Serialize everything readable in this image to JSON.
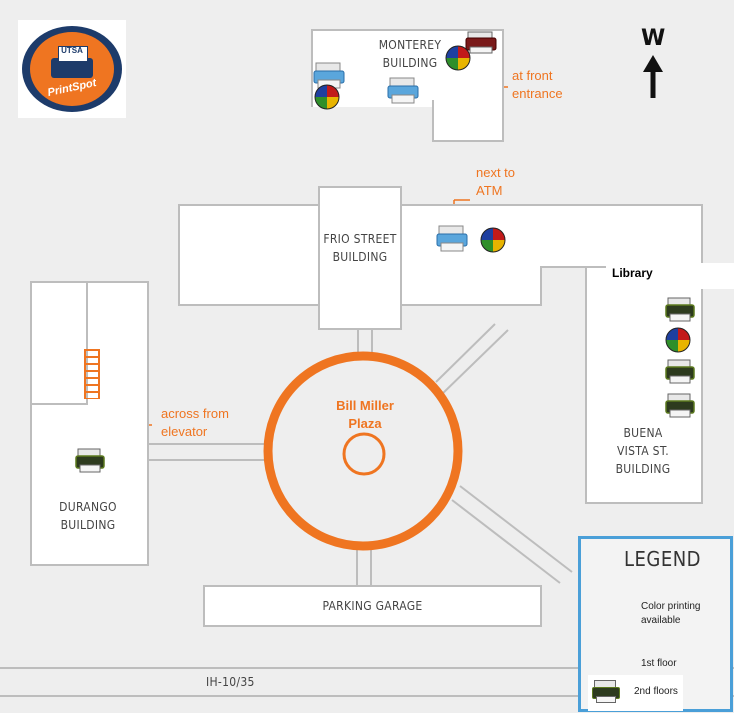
{
  "logo": {
    "top": "UTSA",
    "bottom": "PrintSpot"
  },
  "compass": {
    "letter": "W"
  },
  "buildings": {
    "monterey": "MONTEREY\nBUILDING",
    "frio": "FRIO STREET\nBUILDING",
    "library": "Library",
    "buena_vista": "BUENA\nVISTA ST.\nBUILDING",
    "durango": "DURANGO\nBUILDING",
    "parking": "PARKING GARAGE",
    "plaza": "Bill Miller\nPlaza"
  },
  "annotations": {
    "front_entrance": "at front\nentrance",
    "atm": "next to\nATM",
    "elevator": "across from\nelevator"
  },
  "road": "IH-10/35",
  "legend": {
    "title": "LEGEND",
    "color": "Color printing\navailable",
    "floor1": "1st floor",
    "floor2": "2nd floors"
  },
  "colors": {
    "orange": "#ef7521",
    "legend_border": "#4a9fd8",
    "navy": "#1d3b6a"
  }
}
